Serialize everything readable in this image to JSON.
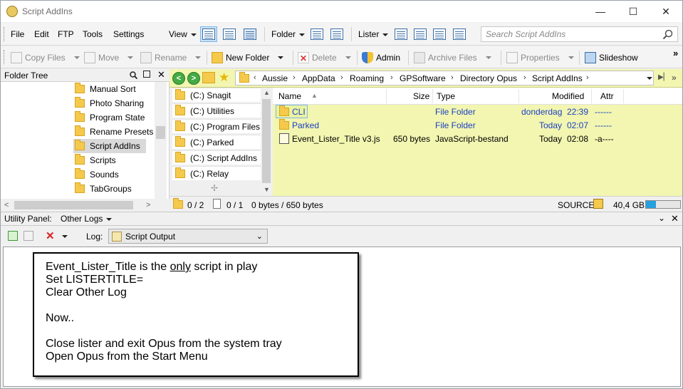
{
  "window": {
    "title": "Script AddIns",
    "minimize": "—",
    "maximize": "☐",
    "close": "✕"
  },
  "menu": {
    "items": [
      "File",
      "Edit",
      "FTP",
      "Tools",
      "Settings"
    ],
    "view": "View",
    "folder": "Folder",
    "lister": "Lister",
    "search_placeholder": "Search Script AddIns"
  },
  "toolbar": {
    "copy_files": "Copy Files",
    "move": "Move",
    "rename": "Rename",
    "new_folder": "New Folder",
    "delete": "Delete",
    "admin": "Admin",
    "archive_files": "Archive Files",
    "properties": "Properties",
    "slideshow": "Slideshow",
    "overflow": "»"
  },
  "folder_tree": {
    "title": "Folder Tree",
    "items": [
      {
        "label": "Manual Sort"
      },
      {
        "label": "Photo Sharing"
      },
      {
        "label": "Program State"
      },
      {
        "label": "Rename Presets"
      },
      {
        "label": "Script AddIns",
        "selected": true
      },
      {
        "label": "Scripts"
      },
      {
        "label": "Sounds"
      },
      {
        "label": "TabGroups"
      }
    ]
  },
  "location": {
    "crumbs": [
      "Aussie",
      "AppData",
      "Roaming",
      "GPSoftware",
      "Directory Opus",
      "Script AddIns"
    ]
  },
  "favorites": [
    "(C:) Snagit",
    "(C:) Utilities",
    "(C:) Program Files",
    "(C:) Parked",
    "(C:) Script AddIns",
    "(C:) Relay"
  ],
  "columns": {
    "name": "Name",
    "size": "Size",
    "type": "Type",
    "modified": "Modified",
    "attr": "Attr"
  },
  "files": [
    {
      "name": "CLI",
      "size": "",
      "type": "File Folder",
      "modified_day": "donderdag",
      "modified_time": "22:39",
      "attr": "------",
      "folder": true
    },
    {
      "name": "Parked",
      "size": "",
      "type": "File Folder",
      "modified_day": "Today",
      "modified_time": "02:07",
      "attr": "------",
      "folder": true
    },
    {
      "name": "Event_Lister_Title v3.js",
      "size": "650 bytes",
      "type": "JavaScript-bestand",
      "modified_day": "Today",
      "modified_time": "02:08",
      "attr": "-a----",
      "folder": false
    }
  ],
  "status": {
    "dirs": "0 / 2",
    "files": "0 / 1",
    "bytes": "0 bytes / 650 bytes",
    "source": "SOURCE",
    "free_space": "40,4 GB",
    "free_fraction": 0.3
  },
  "utility_panel": {
    "label": "Utility Panel:",
    "mode": "Other Logs",
    "log_label": "Log:",
    "log_value": "Script Output"
  },
  "note": {
    "line1_pre": "Event_Lister_Title is the ",
    "line1_u": "only",
    "line1_post": " script in play",
    "line2": "Set LISTERTITLE=",
    "line3": "Clear Other Log",
    "line4": "Now..",
    "line5": "Close lister and exit Opus from the system tray",
    "line6": "Open Opus from the Start Menu"
  }
}
